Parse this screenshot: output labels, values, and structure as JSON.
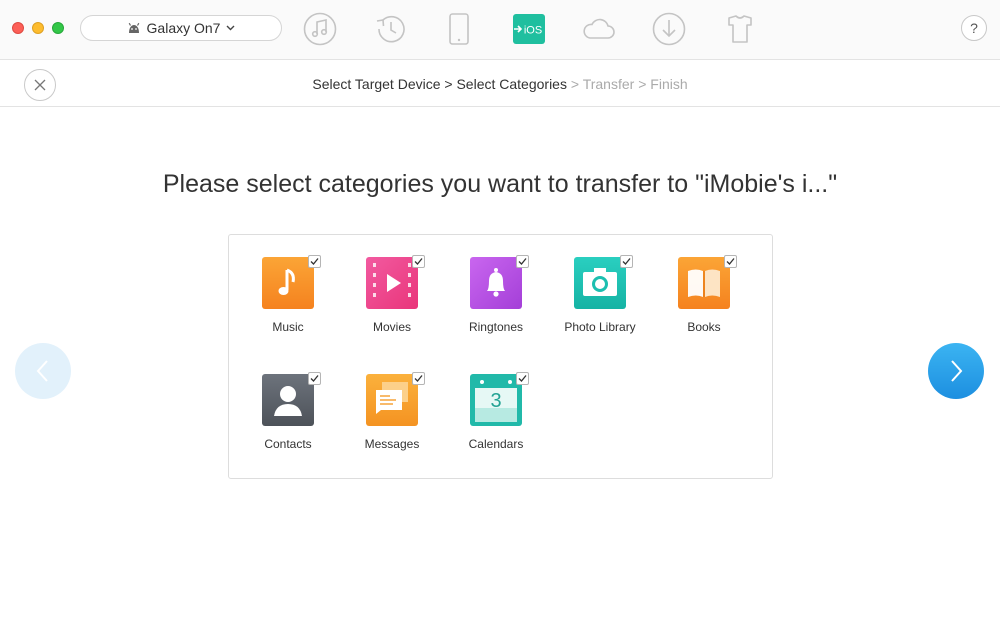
{
  "toolbar": {
    "device_name": "Galaxy On7",
    "ios_badge": "iOS",
    "help_label": "?"
  },
  "stepbar": {
    "step1": "Select Target Device",
    "step2": "Select Categories",
    "step3": "Transfer",
    "step4": "Finish",
    "sep": ">"
  },
  "heading": "Please select categories you want to transfer to \"iMobie's i...\"",
  "categories": [
    {
      "label": "Music",
      "checked": true,
      "icon": "music-icon",
      "color": "#f7941d"
    },
    {
      "label": "Movies",
      "checked": true,
      "icon": "movie-icon",
      "color": "#ef4f8f"
    },
    {
      "label": "Ringtones",
      "checked": true,
      "icon": "bell-icon",
      "color": "#b34ee0"
    },
    {
      "label": "Photo Library",
      "checked": true,
      "icon": "camera-icon",
      "color": "#1cbfb0"
    },
    {
      "label": "Books",
      "checked": true,
      "icon": "book-icon",
      "color": "#f7941d"
    },
    {
      "label": "Contacts",
      "checked": true,
      "icon": "contact-icon",
      "color": "#5b6068"
    },
    {
      "label": "Messages",
      "checked": true,
      "icon": "message-icon",
      "color": "#f7a025"
    },
    {
      "label": "Calendars",
      "checked": true,
      "icon": "calendar-icon",
      "color": "#21b9a9",
      "day": "3"
    }
  ],
  "colors": {
    "accent": "#2a9de6",
    "dim_text": "#aaaaaa"
  }
}
